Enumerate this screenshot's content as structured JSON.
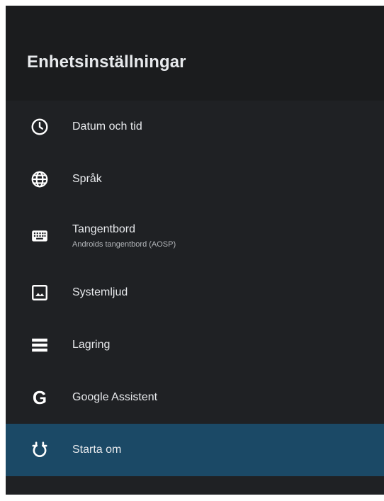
{
  "header": {
    "title": "Enhetsinställningar"
  },
  "menu": {
    "items": [
      {
        "label": "Datum och tid",
        "icon": "clock-icon"
      },
      {
        "label": "Språk",
        "icon": "globe-icon"
      },
      {
        "label": "Tangentbord",
        "sublabel": "Androids tangentbord (AOSP)",
        "icon": "keyboard-icon"
      },
      {
        "label": "Systemljud",
        "icon": "image-icon"
      },
      {
        "label": "Lagring",
        "icon": "storage-icon"
      },
      {
        "label": "Google Assistent",
        "icon": "google-g-icon"
      },
      {
        "label": "Starta om",
        "icon": "restart-icon",
        "selected": true
      }
    ]
  },
  "colors": {
    "background": "#1f2124",
    "header": "#1b1c1e",
    "selected": "#1b4966",
    "text": "#e8eaed",
    "subtext": "#b4b7bb"
  }
}
